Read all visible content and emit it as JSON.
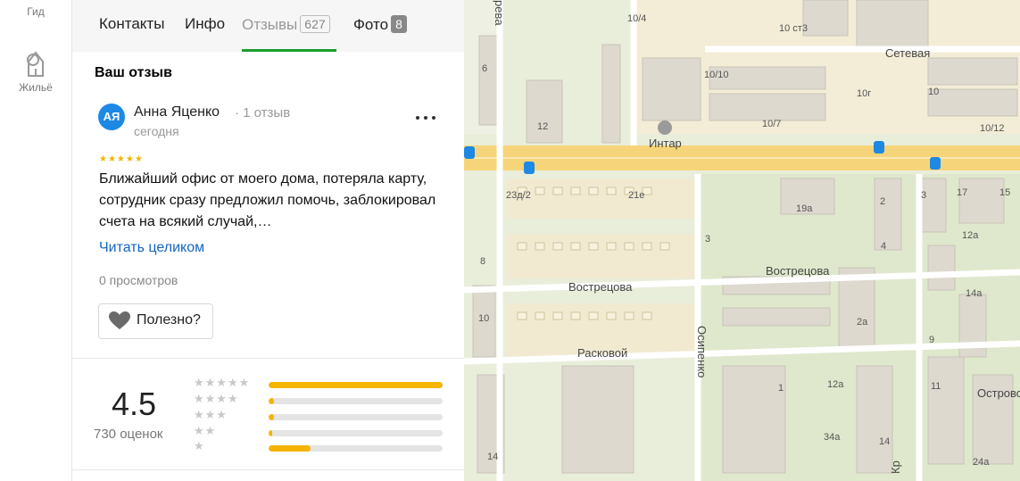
{
  "rail": {
    "guide_label": "Гид",
    "housing_label": "Жильё"
  },
  "tabs": [
    {
      "label": "Контакты"
    },
    {
      "label": "Инфо"
    },
    {
      "label": "Отзывы",
      "count": "627",
      "active": true
    },
    {
      "label": "Фото",
      "count": "8"
    }
  ],
  "review": {
    "section_title": "Ваш отзыв",
    "avatar_initials": "АЯ",
    "author": "Анна Яценко",
    "author_meta": "· 1 отзыв",
    "date": "сегодня",
    "stars": "★★★★★",
    "text": "Ближайший офис от моего дома, потеряла карту, сотрудник сразу предложил помочь, заблокировал счета на всякий случай,…",
    "read_more": "Читать целиком",
    "views": "0 просмотров",
    "useful_label": "Полезно?",
    "more_icon": "more-dots-icon"
  },
  "rating": {
    "value": "4.5",
    "count_label": "730 оценок",
    "distribution": [
      {
        "stars": "★★★★★",
        "fraction": 1.0
      },
      {
        "stars": "★★★★",
        "fraction": 0.03
      },
      {
        "stars": "★★★",
        "fraction": 0.03
      },
      {
        "stars": "★★",
        "fraction": 0.01
      },
      {
        "stars": "★",
        "fraction": 0.24
      }
    ],
    "accent": "#f4b400"
  },
  "map": {
    "streets": [
      "Интар",
      "Сетевая",
      "Вострецова",
      "Вострецова",
      "Расковой",
      "Осипенко",
      "Острово",
      "ревa",
      "Кр"
    ],
    "house_numbers": [
      "10/4",
      "10 ст3",
      "10/10",
      "10г",
      "10",
      "10/7",
      "10/12",
      "6",
      "12",
      "23д/2",
      "21е",
      "19а",
      "3",
      "17",
      "15",
      "12а",
      "2",
      "4",
      "8",
      "3",
      "14а",
      "10",
      "2а",
      "9",
      "1",
      "12а",
      "11",
      "34а",
      "14",
      "14",
      "24а"
    ],
    "colors": {
      "accent": "#1a9e2c",
      "link": "#1565c0",
      "avatar": "#1e88e5"
    }
  }
}
